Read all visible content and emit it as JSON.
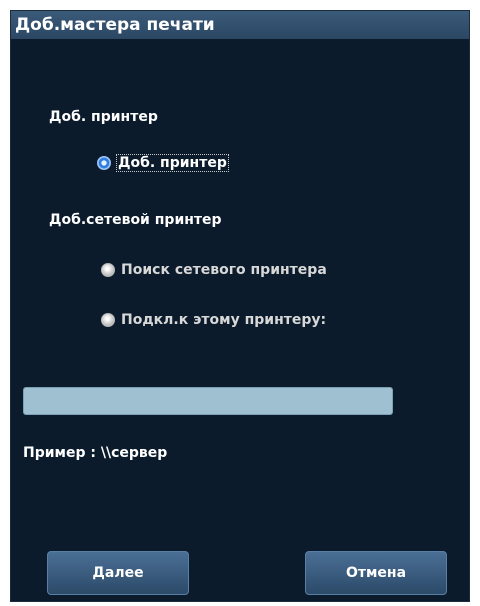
{
  "window": {
    "title": "Доб.мастера печати"
  },
  "sections": {
    "add_printer_label": "Доб. принтер",
    "network_label": "Доб.сетевой принтер"
  },
  "options": {
    "add_printer": "Доб. принтер",
    "search_network": "Поиск сетевого принтера",
    "connect_to": "Подкл.к этому принтеру:"
  },
  "server_input": {
    "value": ""
  },
  "example_text": "Пример : \\\\сервер",
  "buttons": {
    "next": "Далее",
    "cancel": "Отмена"
  }
}
